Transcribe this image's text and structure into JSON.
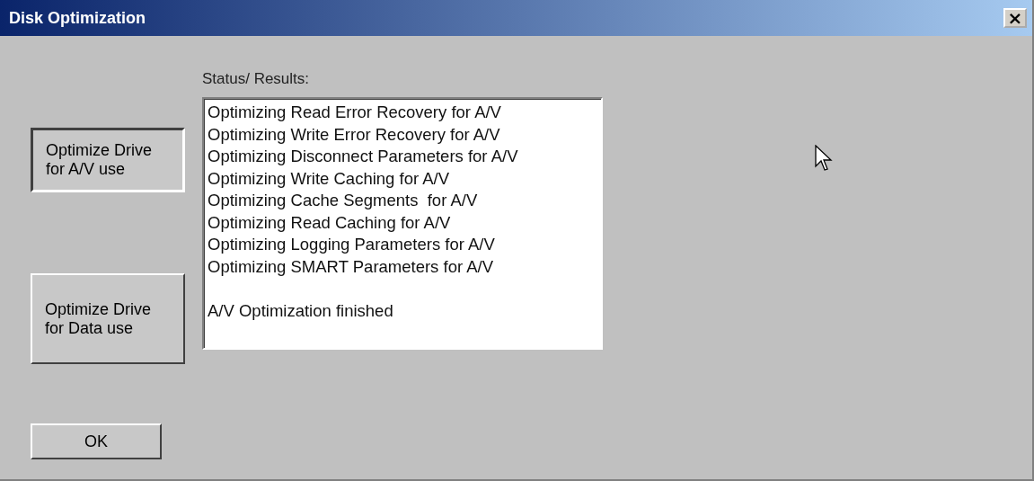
{
  "window": {
    "title": "Disk Optimization",
    "close": "×"
  },
  "buttons": [
    {
      "label": "Optimize Drive\nfor A/V use",
      "pressed": true
    },
    {
      "label": "Optimize Drive\nfor Data use",
      "pressed": false
    }
  ],
  "status": {
    "label": "Status/ Results:",
    "lines": [
      "Optimizing Read Error Recovery for A/V",
      "Optimizing Write Error Recovery for A/V",
      "Optimizing Disconnect Parameters for A/V",
      "Optimizing Write Caching for A/V",
      "Optimizing Cache Segments  for A/V",
      "Optimizing Read Caching for A/V",
      "Optimizing Logging Parameters for A/V",
      "Optimizing SMART Parameters for A/V"
    ],
    "summary": "A/V Optimization finished"
  },
  "ok_button": "OK"
}
